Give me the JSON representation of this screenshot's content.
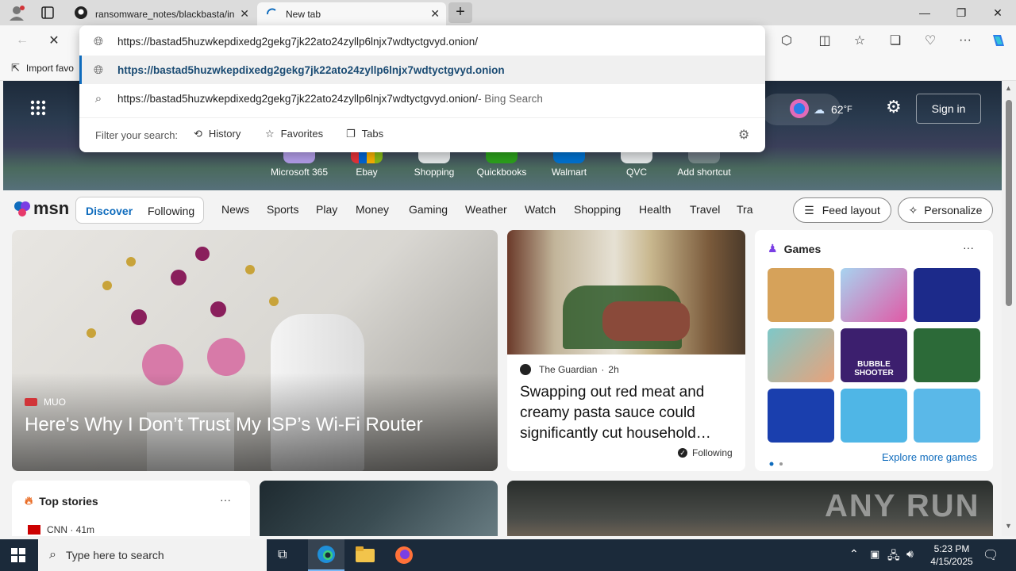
{
  "tabs": [
    {
      "title": "ransomware_notes/blackbasta/in",
      "close": "✕"
    },
    {
      "title": "New tab",
      "close": "✕"
    }
  ],
  "new_tab": "+",
  "window_controls": {
    "minimize": "—",
    "restore": "❐",
    "close": "✕"
  },
  "omnibox": {
    "typed": "https://bastad5huzwkepdixedg2gekg7jk22ato24zyllp6lnjx7wdtyctgvyd.onion/",
    "suggestion_url": "https://bastad5huzwkepdixedg2gekg7jk22ato24zyllp6lnjx7wdtyctgvyd.onion",
    "suggestion_search": "https://bastad5huzwkepdixedg2gekg7jk22ato24zyllp6lnjx7wdtyctgvyd.onion/",
    "search_suffix": " - Bing Search",
    "filter_label": "Filter your search:",
    "filters": [
      "History",
      "Favorites",
      "Tabs"
    ]
  },
  "favbar": {
    "import": "Import favo"
  },
  "header": {
    "temperature": "62",
    "temp_unit": "°F",
    "sign_in": "Sign in"
  },
  "shortcuts": [
    "Microsoft 365",
    "Ebay",
    "Shopping",
    "Quickbooks",
    "Walmart",
    "QVC",
    "Add shortcut"
  ],
  "nav": {
    "logo": "msn",
    "discover": "Discover",
    "following": "Following",
    "links": [
      "News",
      "Sports",
      "Play",
      "Money",
      "Gaming",
      "Weather",
      "Watch",
      "Shopping",
      "Health",
      "Travel",
      "Tra"
    ],
    "feed_layout": "Feed layout",
    "personalize": "Personalize"
  },
  "hero_card": {
    "source": "MUO",
    "headline": "Here's Why I Don’t Trust My ISP’s Wi-Fi Router"
  },
  "guardian_card": {
    "source": "The Guardian",
    "age": "2h",
    "headline": "Swapping out red meat and creamy pasta sauce could significantly cut household…",
    "following": "Following"
  },
  "games": {
    "title": "Games",
    "more": "···",
    "explore": "Explore more games",
    "bubble_label": "BUBBLE SHOOTER"
  },
  "top_stories": {
    "title": "Top stories",
    "more": "···",
    "source": "CNN · 41m"
  },
  "watermark": "ANY RUN",
  "taskbar": {
    "search_placeholder": "Type here to search",
    "time": "5:23 PM",
    "date": "4/15/2025"
  },
  "colors": {
    "accent": "#0f6cbd",
    "taskbar": "#1b2a3a"
  }
}
